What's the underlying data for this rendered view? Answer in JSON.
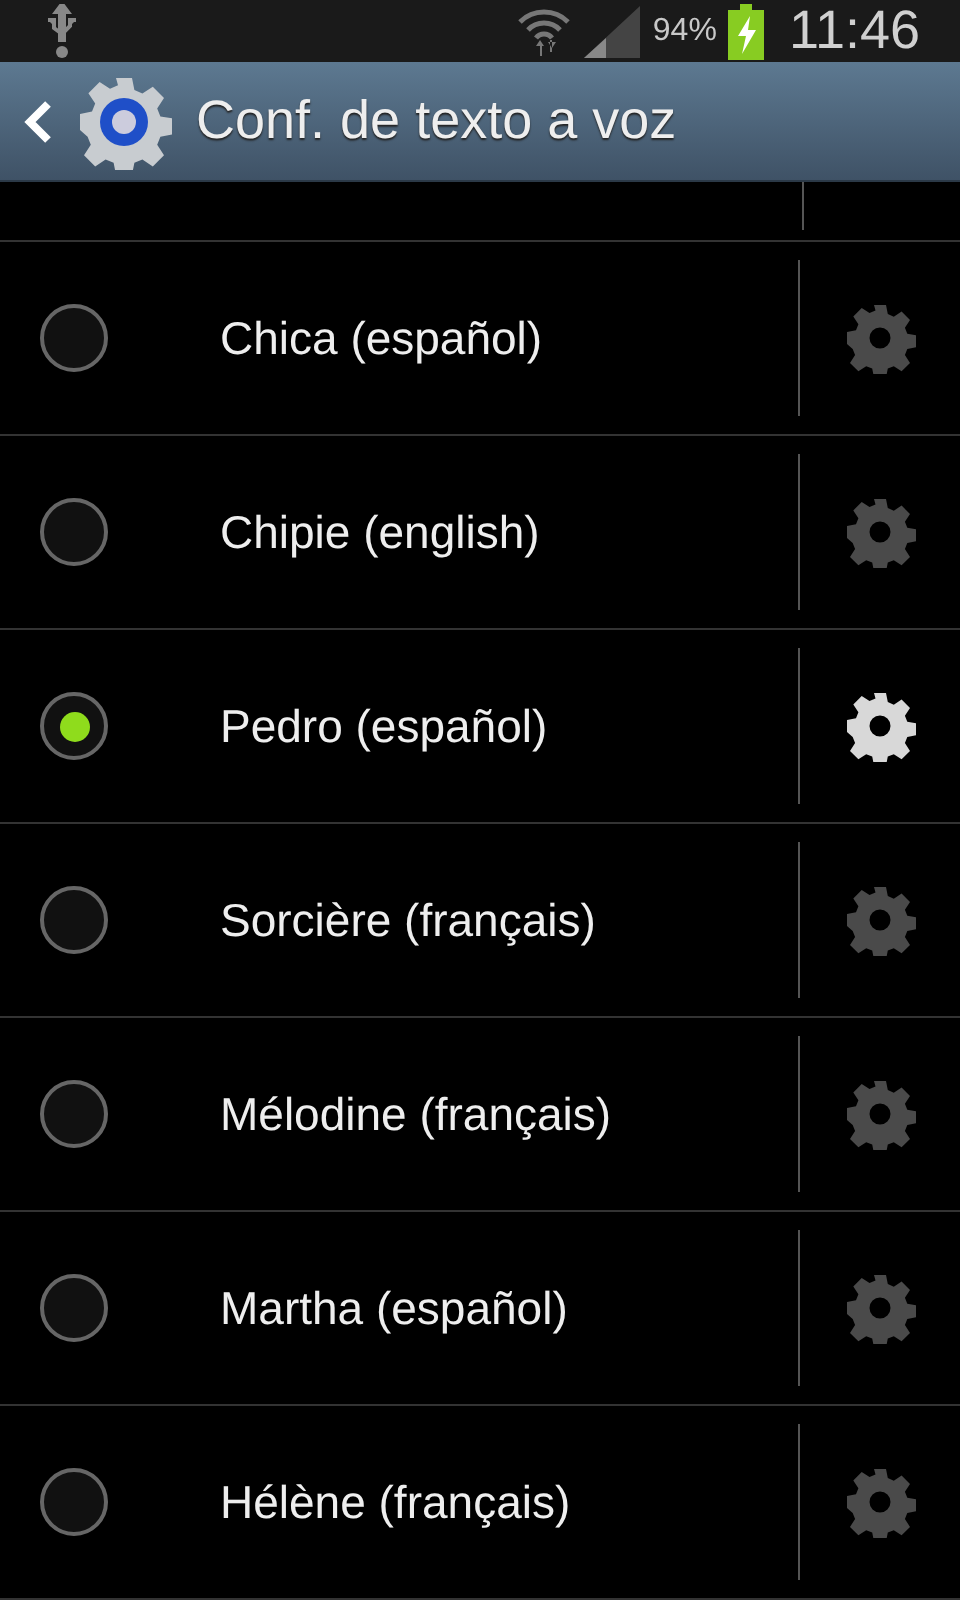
{
  "status_bar": {
    "battery": "94%",
    "time": "11:46"
  },
  "action_bar": {
    "title": "Conf. de texto a voz"
  },
  "voices": [
    {
      "name": "Chica (español)",
      "selected": false
    },
    {
      "name": "Chipie (english)",
      "selected": false
    },
    {
      "name": "Pedro (español)",
      "selected": true
    },
    {
      "name": "Sorcière (français)",
      "selected": false
    },
    {
      "name": "Mélodine (français)",
      "selected": false
    },
    {
      "name": "Martha (español)",
      "selected": false
    },
    {
      "name": "Hélène (français)",
      "selected": false
    }
  ]
}
